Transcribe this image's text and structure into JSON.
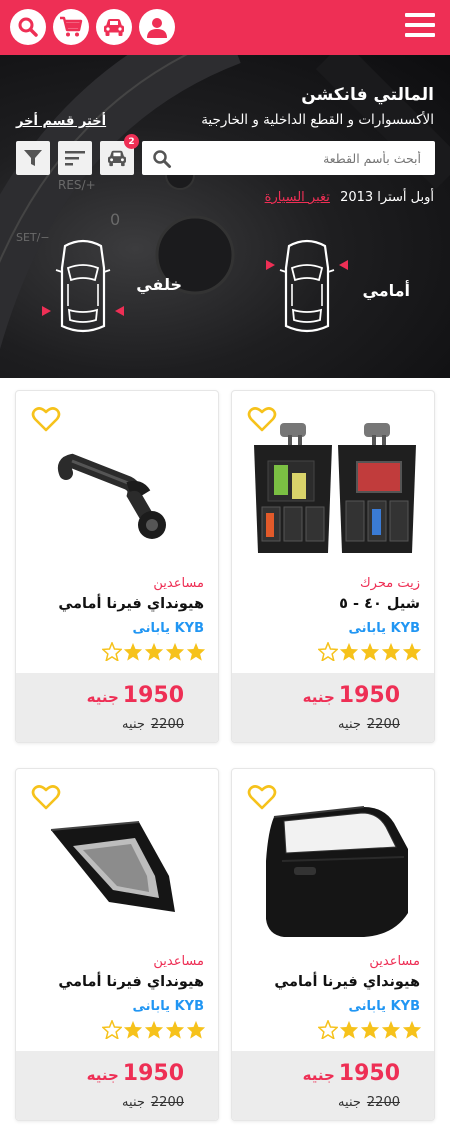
{
  "topbar": {
    "icons": [
      "search-icon",
      "cart-icon",
      "car-icon",
      "user-icon",
      "menu-icon"
    ],
    "color": "#ee2f55"
  },
  "hero": {
    "title": "المالتي فانكشن",
    "subtitle": "الأكسسوارات و القطع الداخلية و الخارجية",
    "choose_section": "أختر قسم أخر",
    "search_placeholder": "أبحث بأسم القطعة",
    "garage_count": "2",
    "car_model": "أوبل أسترا 2013",
    "change_car": "تغير السيارة",
    "front_label": "أمامي",
    "rear_label": "خلفي"
  },
  "products": [
    {
      "category": "زيت محرك",
      "name": "شيل ٤٠ - ٥",
      "brand": "KYB يابانى",
      "rating": 4,
      "rating_max": 5,
      "price": "1950",
      "old_price": "2200",
      "currency": "جنيه",
      "image": "seat-organizer"
    },
    {
      "category": "مساعدين",
      "name": "هيونداي فيرنا أمامي",
      "brand": "KYB يابانى",
      "rating": 4,
      "rating_max": 5,
      "price": "1950",
      "old_price": "2200",
      "currency": "جنيه",
      "image": "window-crank"
    },
    {
      "category": "مساعدين",
      "name": "هيونداي فيرنا أمامي",
      "brand": "KYB يابانى",
      "rating": 4,
      "rating_max": 5,
      "price": "1950",
      "old_price": "2200",
      "currency": "جنيه",
      "image": "car-door"
    },
    {
      "category": "مساعدين",
      "name": "هيونداي فيرنا أمامي",
      "brand": "KYB يابانى",
      "rating": 4,
      "rating_max": 5,
      "price": "1950",
      "old_price": "2200",
      "currency": "جنيه",
      "image": "door-handle"
    }
  ],
  "colors": {
    "accent": "#ee2f55",
    "star": "#f6c21b",
    "brand": "#2196f3"
  }
}
